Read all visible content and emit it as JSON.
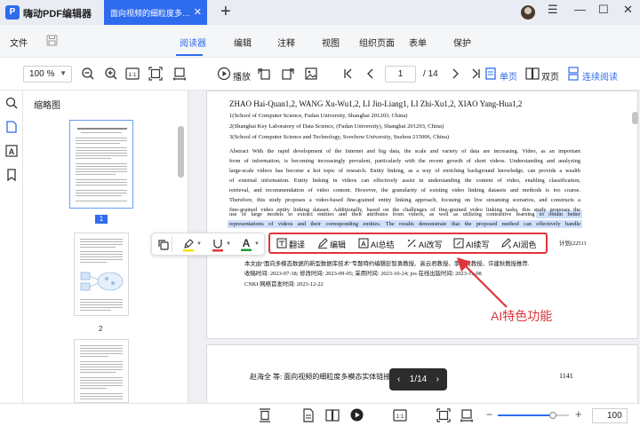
{
  "app": {
    "name": "嗨动PDF编辑器",
    "tab_title": "面向视频的细粒度多模态实体链接"
  },
  "menu": {
    "file": "文件",
    "tabs": [
      "阅读器",
      "编辑",
      "注释",
      "视图",
      "组织页面",
      "表单",
      "保护"
    ],
    "active_tab": "阅读器"
  },
  "toolbar": {
    "zoom": "100 %",
    "play": "播放",
    "page_current": "1",
    "page_total": "/ 14",
    "single": "单页",
    "double": "双页",
    "continuous": "连续阅读"
  },
  "thumbnails": {
    "title": "缩略图",
    "pages": [
      "1",
      "2"
    ]
  },
  "document": {
    "authors": "ZHAO Hai-Quan1,2, WANG Xu-Wu1,2, LI Jin-Liang1, LI Zhi-Xu1,2, XIAO Yang-Hua1,2",
    "affiliations": [
      "1(School of Computer Science, Fudan University, Shanghai 201203, China)",
      "2(Shanghai Key Laboratory of Data Science, (Fudan University), Shanghai 201203, China)",
      "3(School of Computer Science and Technology, Soochow University, Suzhou 215006, China)"
    ],
    "abstract_lines": [
      "Abstract  With the rapid development of the Internet and big data, the scale and variety of data are increasing. Video, as an important",
      "form of information, is becoming increasingly prevalent, particularly with the recent growth of short videos. Understanding and analyzing",
      "large-scale videos has become a hot topic of research. Entity linking, as a way of enriching background knowledge, can provide a wealth",
      "of external information. Entity linking in videos can effectively assist in understanding the content of video, enabling classification,",
      "retrieval, and recommendation of video content. However, the granularity of existing video linking datasets and methods is too coarse.",
      "Therefore, this study proposes a video-based fine-grained entity linking approach, focusing on live streaming scenarios, and constructs a",
      "fine-grained video entity linking dataset. Additionally, based on the challenges of fine-grained video linking tasks, this study proposes the",
      "use of large models to extract entities and their attributes from videos, as well as utilizing contrastive learning to obtain better",
      "representations of videos and their corresponding entities. The results demonstrate that the proposed method can effectively handle"
    ],
    "cn_partial": "计划(22511",
    "cn_lines": [
      "本文由“面向多模态数据的新型数据库技术”专题特约编辑彭智勇教授、高云君教授、李国良教授、许建秋教授推荐.",
      "收稿时间: 2023-07-18; 修改时间: 2023-09-05; 采用时间: 2023-10-24; jos 在线出版时间: 2023-11-08",
      "CNKI 网络首发时间: 2023-12-22"
    ],
    "page2_header": "赵海全 等: 面向视频的细粒度多模态实体链接",
    "page2_number": "1141",
    "page_indicator": "1/14"
  },
  "ai_toolbar": {
    "items": [
      "翻译",
      "编辑",
      "AI总结",
      "AI改写",
      "AI续写",
      "AI润色"
    ],
    "annotation": "AI特色功能",
    "highlight_color": "#e0343b"
  },
  "status": {
    "zoom": "100",
    "zoom_fraction": 0.78
  },
  "colors": {
    "accent": "#2f6bed",
    "annotation_red": "#e0343b"
  }
}
